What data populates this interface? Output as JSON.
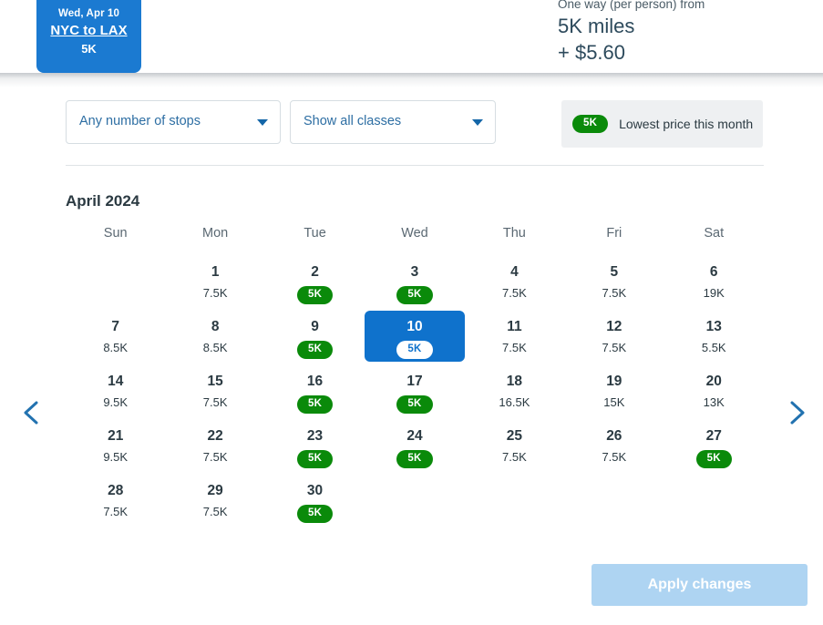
{
  "header": {
    "flight_tab": {
      "date": "Wed, Apr 10",
      "route": "NYC to LAX",
      "price": "5K"
    },
    "price_summary": {
      "label": "One way (per person) from",
      "miles": "5K miles",
      "tax": "+ $5.60"
    }
  },
  "filters": {
    "stops": {
      "value": "Any number of stops"
    },
    "cabin_class": {
      "value": "Show all classes"
    },
    "legend": {
      "pill": "5K",
      "text": "Lowest price this month"
    }
  },
  "calendar": {
    "month_title": "April 2024",
    "weekdays": [
      "Sun",
      "Mon",
      "Tue",
      "Wed",
      "Thu",
      "Fri",
      "Sat"
    ],
    "prev_label": "Previous month",
    "next_label": "Next month",
    "weeks": [
      [
        {
          "day": "",
          "price": "",
          "lowest": false,
          "selected": false,
          "empty": true
        },
        {
          "day": "1",
          "price": "7.5K",
          "lowest": false,
          "selected": false
        },
        {
          "day": "2",
          "price": "5K",
          "lowest": true,
          "selected": false
        },
        {
          "day": "3",
          "price": "5K",
          "lowest": true,
          "selected": false
        },
        {
          "day": "4",
          "price": "7.5K",
          "lowest": false,
          "selected": false
        },
        {
          "day": "5",
          "price": "7.5K",
          "lowest": false,
          "selected": false
        },
        {
          "day": "6",
          "price": "19K",
          "lowest": false,
          "selected": false
        }
      ],
      [
        {
          "day": "7",
          "price": "8.5K",
          "lowest": false,
          "selected": false
        },
        {
          "day": "8",
          "price": "8.5K",
          "lowest": false,
          "selected": false
        },
        {
          "day": "9",
          "price": "5K",
          "lowest": true,
          "selected": false
        },
        {
          "day": "10",
          "price": "5K",
          "lowest": true,
          "selected": true
        },
        {
          "day": "11",
          "price": "7.5K",
          "lowest": false,
          "selected": false
        },
        {
          "day": "12",
          "price": "7.5K",
          "lowest": false,
          "selected": false
        },
        {
          "day": "13",
          "price": "5.5K",
          "lowest": false,
          "selected": false
        }
      ],
      [
        {
          "day": "14",
          "price": "9.5K",
          "lowest": false,
          "selected": false
        },
        {
          "day": "15",
          "price": "7.5K",
          "lowest": false,
          "selected": false
        },
        {
          "day": "16",
          "price": "5K",
          "lowest": true,
          "selected": false
        },
        {
          "day": "17",
          "price": "5K",
          "lowest": true,
          "selected": false
        },
        {
          "day": "18",
          "price": "16.5K",
          "lowest": false,
          "selected": false
        },
        {
          "day": "19",
          "price": "15K",
          "lowest": false,
          "selected": false
        },
        {
          "day": "20",
          "price": "13K",
          "lowest": false,
          "selected": false
        }
      ],
      [
        {
          "day": "21",
          "price": "9.5K",
          "lowest": false,
          "selected": false
        },
        {
          "day": "22",
          "price": "7.5K",
          "lowest": false,
          "selected": false
        },
        {
          "day": "23",
          "price": "5K",
          "lowest": true,
          "selected": false
        },
        {
          "day": "24",
          "price": "5K",
          "lowest": true,
          "selected": false
        },
        {
          "day": "25",
          "price": "7.5K",
          "lowest": false,
          "selected": false
        },
        {
          "day": "26",
          "price": "7.5K",
          "lowest": false,
          "selected": false
        },
        {
          "day": "27",
          "price": "5K",
          "lowest": true,
          "selected": false
        }
      ],
      [
        {
          "day": "28",
          "price": "7.5K",
          "lowest": false,
          "selected": false
        },
        {
          "day": "29",
          "price": "7.5K",
          "lowest": false,
          "selected": false
        },
        {
          "day": "30",
          "price": "5K",
          "lowest": true,
          "selected": false
        },
        {
          "day": "",
          "price": "",
          "lowest": false,
          "selected": false,
          "empty": true
        },
        {
          "day": "",
          "price": "",
          "lowest": false,
          "selected": false,
          "empty": true
        },
        {
          "day": "",
          "price": "",
          "lowest": false,
          "selected": false,
          "empty": true
        },
        {
          "day": "",
          "price": "",
          "lowest": false,
          "selected": false,
          "empty": true
        }
      ]
    ]
  },
  "footer": {
    "apply_label": "Apply changes"
  },
  "colors": {
    "brand_blue": "#0f72cc",
    "tab_blue": "#1b7ad1",
    "lowest_green": "#0a8a0a",
    "disabled_blue": "#aed4f2"
  }
}
